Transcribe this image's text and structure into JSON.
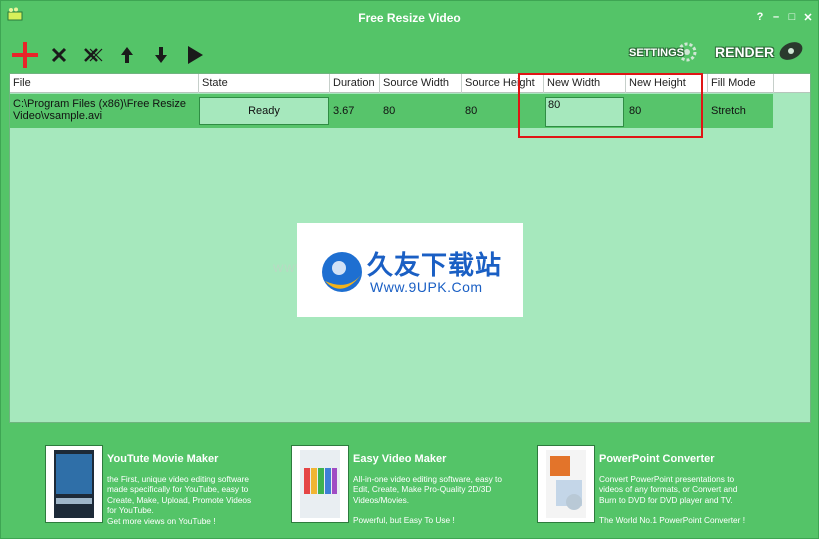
{
  "window": {
    "title": "Free Resize Video",
    "controls": [
      "?",
      "–",
      "□",
      "✕"
    ]
  },
  "toolbar": {
    "icons": [
      "add-icon",
      "remove-icon",
      "clear-all-icon",
      "move-up-icon",
      "move-down-icon",
      "play-icon"
    ],
    "settings_label": "SETTINGS",
    "render_label": "RENDER"
  },
  "grid": {
    "columns": [
      "File",
      "State",
      "Duration",
      "Source Width",
      "Source Height",
      "New Width",
      "New Height",
      "Fill Mode"
    ],
    "rows": [
      {
        "file": "C:\\Program Files (x86)\\Free Resize Video\\vsample.avi",
        "state": "Ready",
        "duration": "3.67",
        "source_width": "80",
        "source_height": "80",
        "new_width": "80",
        "new_height": "80",
        "fill_mode": "Stretch"
      }
    ]
  },
  "watermark": {
    "side_text": "WWW.9UPK.COM",
    "cn_text": "久友下载站",
    "url_text": "Www.9UPK.Com"
  },
  "promos": [
    {
      "title": "YouTute Movie Maker",
      "desc_lines": [
        "the First, unique video editing software",
        "made specifically for YouTube, easy to",
        "Create, Make, Upload, Promote Videos",
        "for YouTube.",
        "Get more views on YouTube !"
      ]
    },
    {
      "title": "Easy Video Maker",
      "desc_lines": [
        "All-in-one video editing software, easy to",
        "Edit, Create, Make Pro-Quality 2D/3D",
        "Videos/Movies.",
        "",
        "Powerful, but Easy To Use !"
      ]
    },
    {
      "title": "PowerPoint Converter",
      "desc_lines": [
        "Convert PowerPoint presentations to",
        "videos of any formats, or Convert and",
        "Burn to DVD for DVD player and TV.",
        "",
        "The World No.1 PowerPoint Converter !"
      ]
    }
  ],
  "colors": {
    "app_bg": "#54c468",
    "grid_bg": "#a6e8bd",
    "row_bg": "#57c46b",
    "highlight": "#e01515",
    "add_icon": "#e8242a"
  }
}
